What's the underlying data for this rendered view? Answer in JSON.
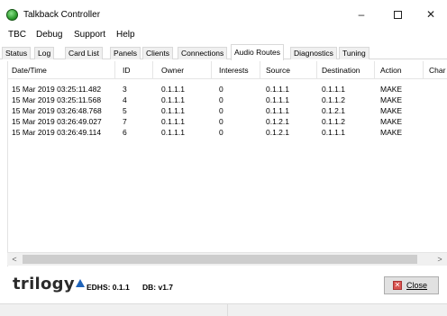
{
  "window": {
    "title": "Talkback Controller",
    "minimize_glyph": "–",
    "close_glyph": "✕"
  },
  "menu": [
    "TBC",
    "Debug",
    "Support",
    "Help"
  ],
  "tabs": [
    "Status",
    "Log",
    "Card List",
    "Panels",
    "Clients",
    "Connections",
    "Audio Routes",
    "Diagnostics",
    "Tuning"
  ],
  "active_tab": "Audio Routes",
  "table": {
    "columns": [
      "Date/Time",
      "ID",
      "Owner",
      "Interests",
      "Source",
      "Destination",
      "Action",
      "Char"
    ],
    "rows": [
      [
        "15 Mar 2019 03:25:11.482",
        "3",
        "0.1.1.1",
        "0",
        "0.1.1.1",
        "0.1.1.1",
        "MAKE"
      ],
      [
        "15 Mar 2019 03:25:11.568",
        "4",
        "0.1.1.1",
        "0",
        "0.1.1.1",
        "0.1.1.2",
        "MAKE"
      ],
      [
        "15 Mar 2019 03:26:48.768",
        "5",
        "0.1.1.1",
        "0",
        "0.1.1.1",
        "0.1.2.1",
        "MAKE"
      ],
      [
        "15 Mar 2019 03:26:49.027",
        "7",
        "0.1.1.1",
        "0",
        "0.1.2.1",
        "0.1.1.2",
        "MAKE"
      ],
      [
        "15 Mar 2019 03:26:49.114",
        "6",
        "0.1.1.1",
        "0",
        "0.1.2.1",
        "0.1.1.1",
        "MAKE"
      ]
    ]
  },
  "scrollbar": {
    "left_arrow": "<",
    "right_arrow": ">"
  },
  "footer": {
    "logo_text": "trilogy",
    "edhs": "EDHS: 0.1.1",
    "db": "DB: v1.7",
    "close_label": "Close"
  },
  "colors": {
    "logo_accent": "#1f63b8",
    "app_icon": "#2f9c2f",
    "close_icon": "#d9534f"
  }
}
